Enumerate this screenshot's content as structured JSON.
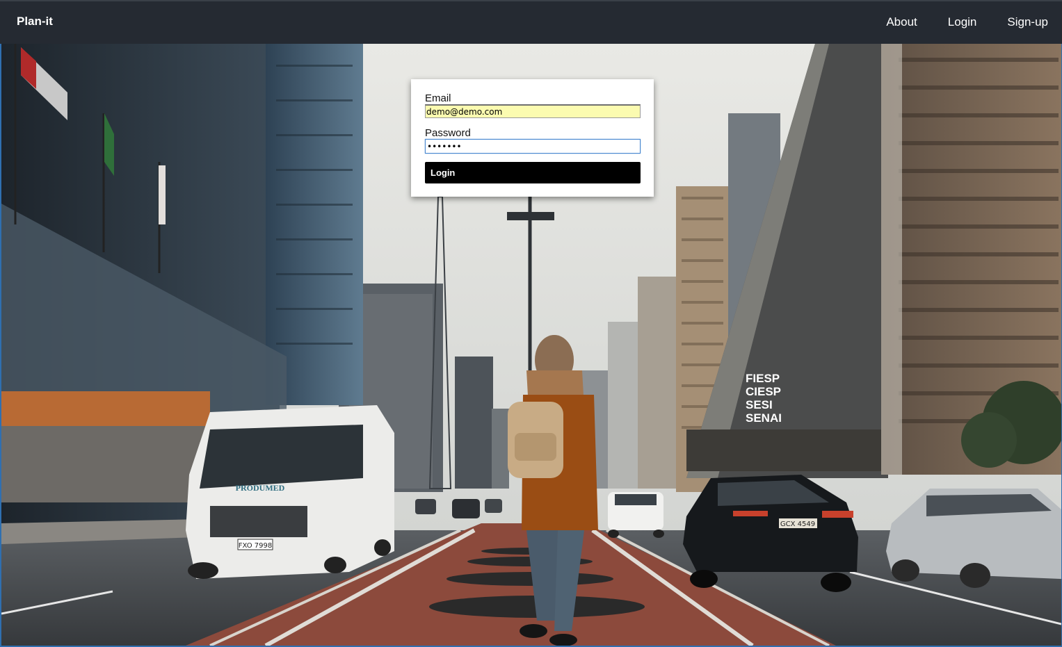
{
  "navbar": {
    "brand": "Plan-it",
    "links": [
      "About",
      "Login",
      "Sign-up"
    ]
  },
  "login_form": {
    "email_label": "Email",
    "email_value": "demo@demo.com",
    "password_label": "Password",
    "password_value": "•••••••",
    "submit_label": "Login"
  },
  "background": {
    "building_sign_lines": [
      "FIESP",
      "CIESP",
      "SESI",
      "SENAI"
    ],
    "van_label": "PRODUMED",
    "van_plate": "FXO 7998",
    "car_plate": "GCX 4549"
  },
  "colors": {
    "navbar_bg": "#252a32",
    "button_bg": "#000000",
    "email_autofill_bg": "#fbfbb0",
    "focus_border": "#4a88d0"
  }
}
